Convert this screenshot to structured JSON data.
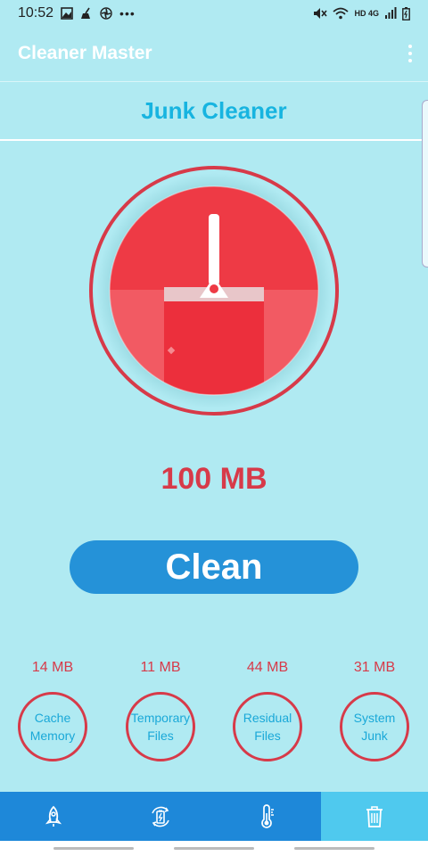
{
  "status": {
    "time": "10:52",
    "more": "•••",
    "network": "HD 4G"
  },
  "app": {
    "title": "Cleaner Master"
  },
  "section": {
    "title": "Junk Cleaner"
  },
  "junk": {
    "total": "100 MB"
  },
  "actions": {
    "clean_label": "Clean"
  },
  "categories": [
    {
      "value": "14 MB",
      "line1": "Cache",
      "line2": "Memory"
    },
    {
      "value": "11 MB",
      "line1": "Temporary",
      "line2": "Files"
    },
    {
      "value": "44 MB",
      "line1": "Residual",
      "line2": "Files"
    },
    {
      "value": "31 MB",
      "line1": "System",
      "line2": "Junk"
    }
  ],
  "nav": {
    "items": [
      {
        "icon": "rocket-icon"
      },
      {
        "icon": "battery-saver-icon"
      },
      {
        "icon": "thermometer-icon"
      },
      {
        "icon": "trash-icon",
        "active": true
      }
    ]
  },
  "colors": {
    "background": "#b0eaf2",
    "accent_red": "#d73a49",
    "title_blue": "#17b4e0",
    "button_blue": "#2592d8",
    "nav_blue": "#1e88d9",
    "nav_active": "#4fc9ee"
  }
}
